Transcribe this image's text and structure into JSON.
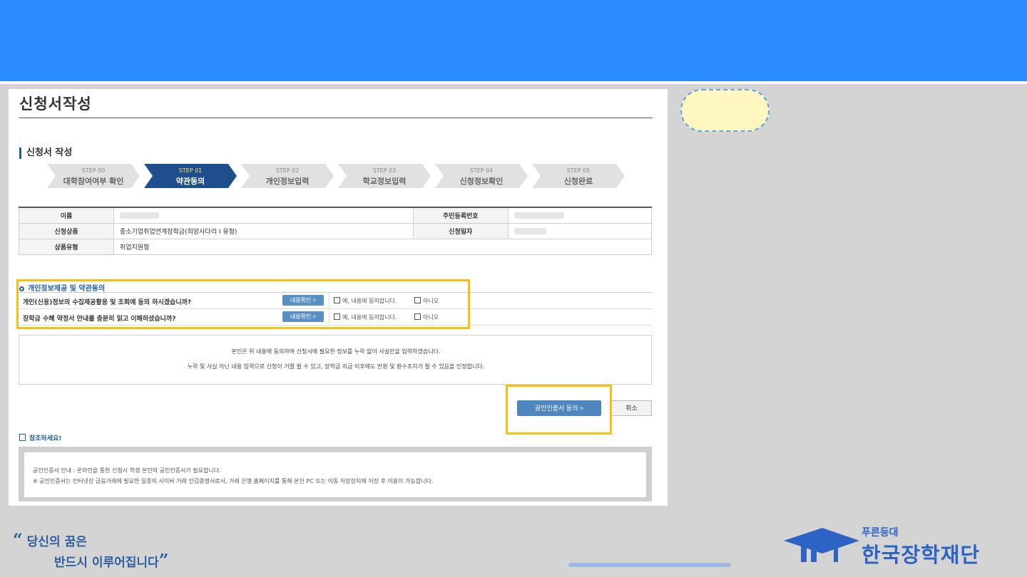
{
  "page": {
    "title": "신청서작성",
    "section_title": "신청서 작성"
  },
  "steps": [
    {
      "num": "STEP 00",
      "label": "대학참여여부 확인",
      "active": false
    },
    {
      "num": "STEP 01",
      "label": "약관동의",
      "active": true
    },
    {
      "num": "STEP 02",
      "label": "개인정보입력",
      "active": false
    },
    {
      "num": "STEP 03",
      "label": "학교정보입력",
      "active": false
    },
    {
      "num": "STEP 04",
      "label": "신청정보확인",
      "active": false
    },
    {
      "num": "STEP 05",
      "label": "신청완료",
      "active": false
    }
  ],
  "info": {
    "name_label": "이름",
    "rrn_label": "주민등록번호",
    "product_label": "신청상품",
    "product_value": "중소기업취업연계장학금(희망사다리 I 유형)",
    "date_label": "신청일자",
    "type_label": "상품유형",
    "type_value": "취업지원형"
  },
  "consent": {
    "title": "개인정보제공 및 약관동의",
    "rows": [
      {
        "question": "개인(신용)정보의 수집제공활용 및 조회에 동의 하시겠습니까?",
        "view_label": "내용확인 >",
        "agree_label": "예, 내용에 동의합니다.",
        "disagree_label": "아니오"
      },
      {
        "question": "장학금 수혜 약정서 안내를 충분히 읽고 이해하셨습니까?",
        "view_label": "내용확인 >",
        "agree_label": "예, 내용에 동의합니다.",
        "disagree_label": "아니오"
      }
    ]
  },
  "notice": {
    "line1": "본인은 위 내용에 동의하며 신청서에 필요한 정보를 누락 없이 사실만을 입력하겠습니다.",
    "line2": "누락 및 사실 아닌 내용 입력으로 신청이 거절 될 수 있고, 장학금 지급 이후에도 반환 및 환수조치가 될 수 있음을 인정합니다."
  },
  "buttons": {
    "cert_agree": "공인인증서 동의 >",
    "cancel": "취소"
  },
  "reference": {
    "title": "참조하세요!",
    "line1": "공인인증서 안내 : 온라인을 통한 신청시 학생 본인의 공인인증서가 필요합니다.",
    "line2": "※ 공인인증서는 인터넷상 금융거래에 필요한 일종의 사이버 거래 인감증명서로서, 거래 은행 홈페이지를 통해 본인 PC 또는 이동 저장장치에 저장 후 이용이 가능합니다."
  },
  "slogan": {
    "open_quote": "“",
    "line1": "당신의 꿈은",
    "line2": "반드시 이루어집니다",
    "close_quote": "”"
  },
  "logo": {
    "sub": "푸른등대",
    "main": "한국장학재단"
  },
  "colors": {
    "top_bar": "#2a8cff",
    "highlight": "#f7bf0e",
    "active_step": "#1f4e8c",
    "brand": "#2c63c4"
  }
}
